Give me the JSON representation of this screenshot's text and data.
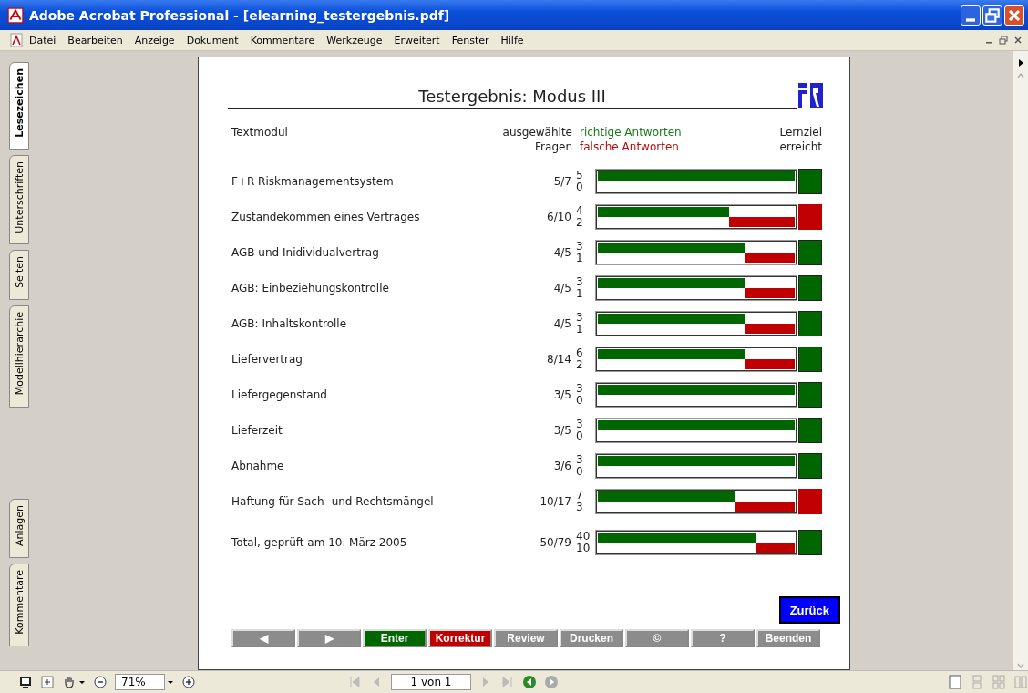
{
  "window": {
    "title": "Adobe Acrobat Professional - [elearning_testergebnis.pdf]"
  },
  "menu": [
    "Datei",
    "Bearbeiten",
    "Anzeige",
    "Dokument",
    "Kommentare",
    "Werkzeuge",
    "Erweitert",
    "Fenster",
    "Hilfe"
  ],
  "side_tabs": [
    {
      "label": "Lesezeichen",
      "selected": true
    },
    {
      "label": "Unterschriften",
      "selected": false
    },
    {
      "label": "Seiten",
      "selected": false
    },
    {
      "label": "Modellhierarchie",
      "selected": false
    },
    {
      "label": "Anlagen",
      "selected": false
    },
    {
      "label": "Kommentare",
      "selected": false
    }
  ],
  "document": {
    "title": "Testergebnis: Modus III",
    "header": {
      "module": "Textmodul",
      "selected_1": "ausgewählte",
      "selected_2": "Fragen",
      "correct": "richtige Antworten",
      "wrong": "falsche Antworten",
      "goal_1": "Lernziel",
      "goal_2": "erreicht"
    },
    "rows": [
      {
        "label": "F+R Riskmanagementsystem",
        "fraction": "5/7",
        "correct": "5",
        "wrong": "0",
        "level": 1,
        "achieved": true
      },
      {
        "label": "Zustandekommen eines Vertrages",
        "fraction": "6/10",
        "correct": "4",
        "wrong": "2",
        "level": 0.667,
        "achieved": false
      },
      {
        "label": "AGB und Inidividualvertrag",
        "fraction": "4/5",
        "correct": "3",
        "wrong": "1",
        "level": 0.75,
        "achieved": true
      },
      {
        "label": "AGB: Einbeziehungskontrolle",
        "fraction": "4/5",
        "correct": "3",
        "wrong": "1",
        "level": 0.75,
        "achieved": true
      },
      {
        "label": "AGB: Inhaltskontrolle",
        "fraction": "4/5",
        "correct": "3",
        "wrong": "1",
        "level": 0.75,
        "achieved": true
      },
      {
        "label": "Liefervertrag",
        "fraction": "8/14",
        "correct": "6",
        "wrong": "2",
        "level": 0.75,
        "achieved": true
      },
      {
        "label": "Liefergegenstand",
        "fraction": "3/5",
        "correct": "3",
        "wrong": "0",
        "level": 1,
        "achieved": true
      },
      {
        "label": "Lieferzeit",
        "fraction": "3/5",
        "correct": "3",
        "wrong": "0",
        "level": 1,
        "achieved": true
      },
      {
        "label": "Abnahme",
        "fraction": "3/6",
        "correct": "3",
        "wrong": "0",
        "level": 1,
        "achieved": true
      },
      {
        "label": "Haftung für Sach- und Rechtsmängel",
        "fraction": "10/17",
        "correct": "7",
        "wrong": "3",
        "level": 0.7,
        "achieved": false
      }
    ],
    "total": {
      "label": "Total, geprüft am 10. März 2005",
      "fraction": "50/79",
      "correct": "40",
      "wrong": "10",
      "level": 0.8,
      "achieved": true
    },
    "back_button": "Zurück",
    "nav_buttons": [
      {
        "label": "◀",
        "color": "#8c8c8c"
      },
      {
        "label": "▶",
        "color": "#8c8c8c"
      },
      {
        "label": "Enter",
        "color": "#006600"
      },
      {
        "label": "Korrektur",
        "color": "#c00000"
      },
      {
        "label": "Review",
        "color": "#8c8c8c"
      },
      {
        "label": "Drucken",
        "color": "#8c8c8c"
      },
      {
        "label": "©",
        "color": "#8c8c8c"
      },
      {
        "label": "?",
        "color": "#8c8c8c"
      },
      {
        "label": "Beenden",
        "color": "#8c8c8c"
      }
    ]
  },
  "status_bar": {
    "zoom": "71%",
    "page": "1 von 1"
  }
}
